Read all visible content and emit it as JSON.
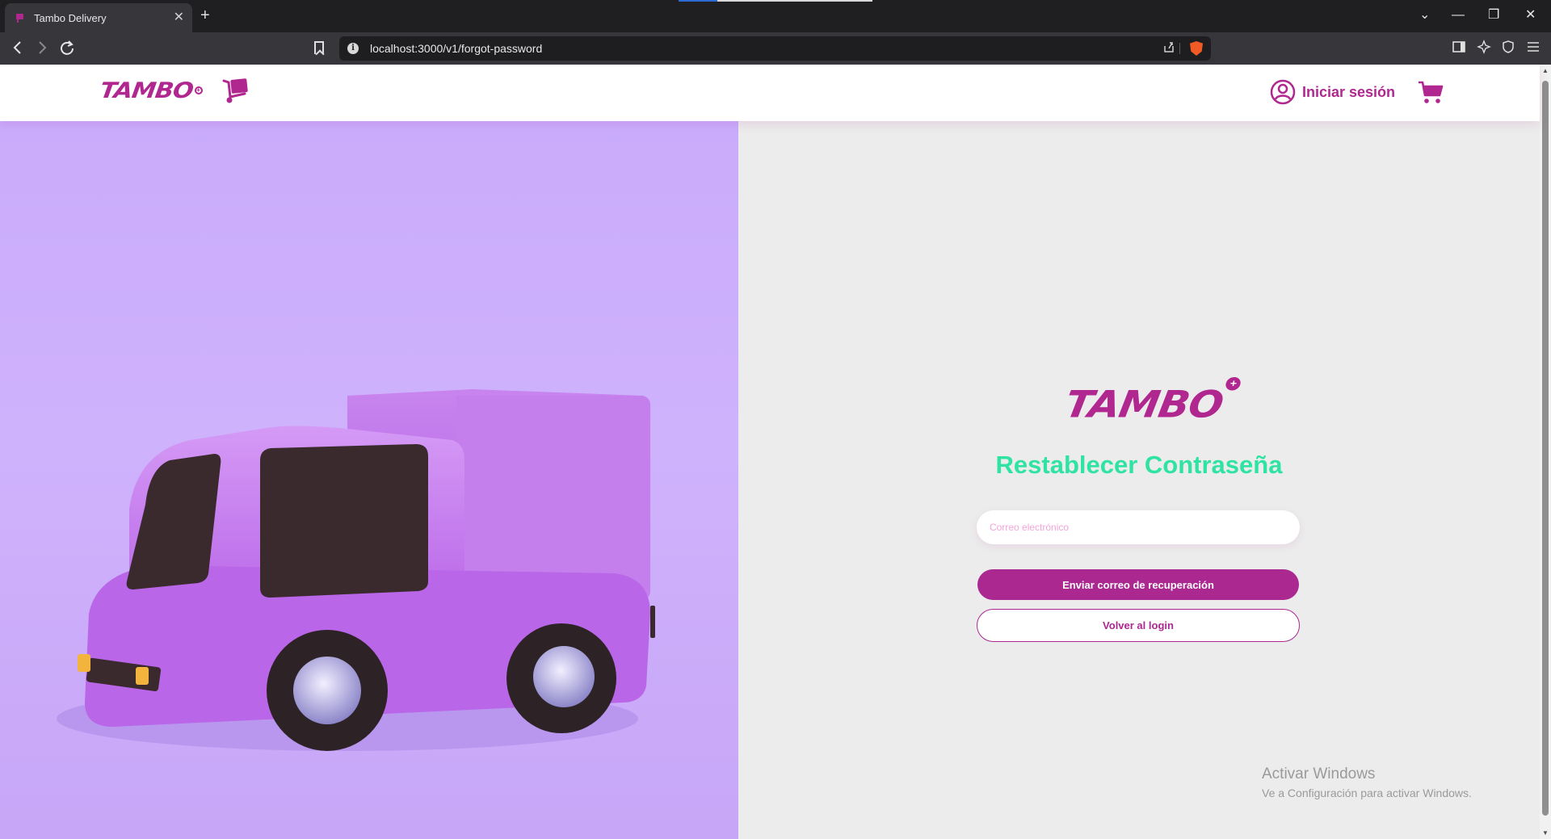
{
  "browser": {
    "tab_title": "Tambo Delivery",
    "tab_close": "✕",
    "new_tab": "+",
    "url": "localhost:3000/v1/forgot-password",
    "window_controls": {
      "minimize": "—",
      "restore": "❐",
      "close": "✕",
      "tab_list": "⌄"
    }
  },
  "header": {
    "logo_text": "TAMBO",
    "login_label": "Iniciar sesión"
  },
  "form": {
    "logo_text": "TAMBO",
    "title": "Restablecer Contraseña",
    "email_placeholder": "Correo electrónico",
    "email_value": "",
    "submit_label": "Enviar correo de recuperación",
    "back_label": "Volver al login"
  },
  "system": {
    "activate_title": "Activar Windows",
    "activate_subtitle": "Ve a Configuración para activar Windows."
  },
  "colors": {
    "brand": "#b0278f",
    "title": "#2fe3a3",
    "hero_background": "#cbaefb",
    "page_background": "#ececec"
  },
  "icons": {
    "header_cart_logo": "hand-truck-icon",
    "user": "user-circle-icon",
    "cart": "shopping-cart-icon",
    "hero": "delivery-truck-illustration"
  }
}
